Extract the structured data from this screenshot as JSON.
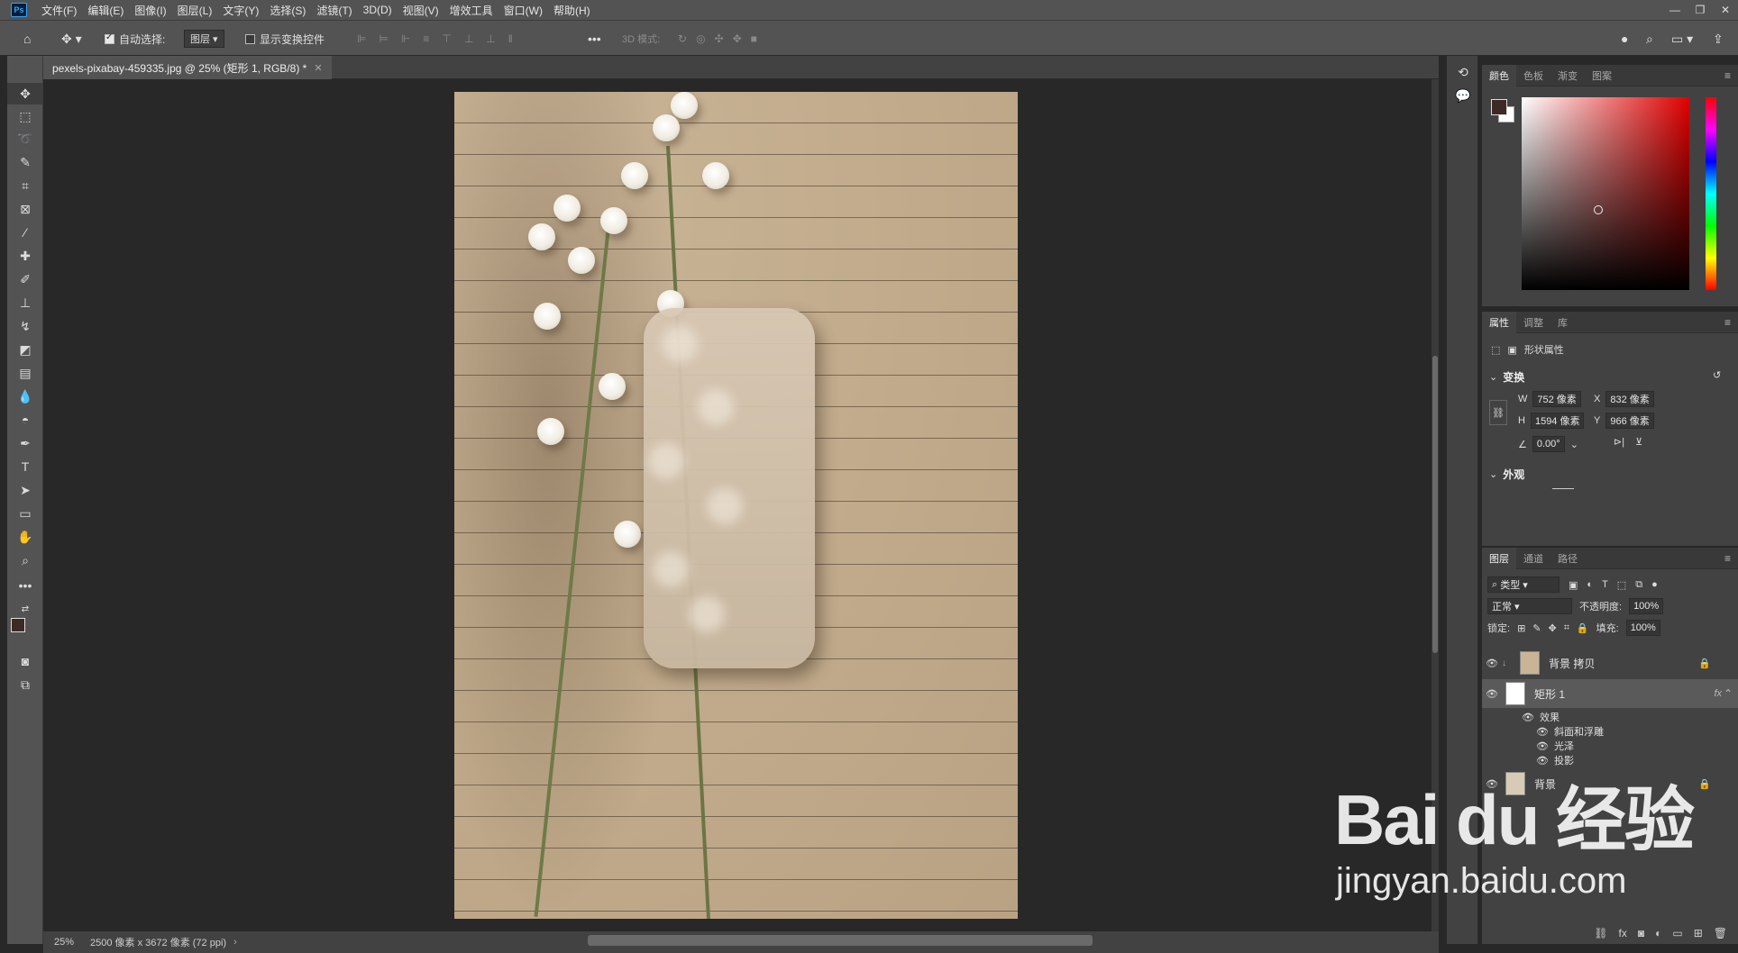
{
  "menu": {
    "logo": "Ps",
    "items": [
      "文件(F)",
      "编辑(E)",
      "图像(I)",
      "图层(L)",
      "文字(Y)",
      "选择(S)",
      "滤镜(T)",
      "3D(D)",
      "视图(V)",
      "增效工具",
      "窗口(W)",
      "帮助(H)"
    ]
  },
  "options": {
    "auto_select_label": "自动选择:",
    "auto_select_value": "图层",
    "show_transform_label": "显示变换控件",
    "mode_3d_label": "3D 模式:"
  },
  "document": {
    "tab_title": "pexels-pixabay-459335.jpg @ 25% (矩形 1, RGB/8) *",
    "zoom": "25%",
    "size_info": "2500 像素 x 3672 像素 (72 ppi)"
  },
  "color_panel": {
    "tabs": [
      "颜色",
      "色板",
      "渐变",
      "图案"
    ],
    "foreground": "#3d2a24",
    "background": "#ffffff"
  },
  "properties": {
    "tabs": [
      "属性",
      "调整",
      "库"
    ],
    "header": "形状属性",
    "transform_label": "变换",
    "w_label": "W",
    "w_value": "752 像素",
    "h_label": "H",
    "h_value": "1594 像素",
    "x_label": "X",
    "x_value": "832 像素",
    "y_label": "Y",
    "y_value": "966 像素",
    "angle": "0.00°",
    "appearance_label": "外观"
  },
  "layers": {
    "tabs": [
      "图层",
      "通道",
      "路径"
    ],
    "filter_kind": "类型",
    "blend_mode": "正常",
    "opacity_label": "不透明度:",
    "opacity_value": "100%",
    "lock_label": "锁定:",
    "fill_label": "填充:",
    "fill_value": "100%",
    "items": [
      {
        "name": "背景 拷贝"
      },
      {
        "name": "矩形 1",
        "fx": "fx"
      },
      {
        "name": "背景"
      }
    ],
    "effects_label": "效果",
    "effects": [
      "斜面和浮雕",
      "光泽",
      "投影"
    ]
  },
  "watermark": {
    "logo": "Bai du 经验",
    "url": "jingyan.baidu.com"
  }
}
